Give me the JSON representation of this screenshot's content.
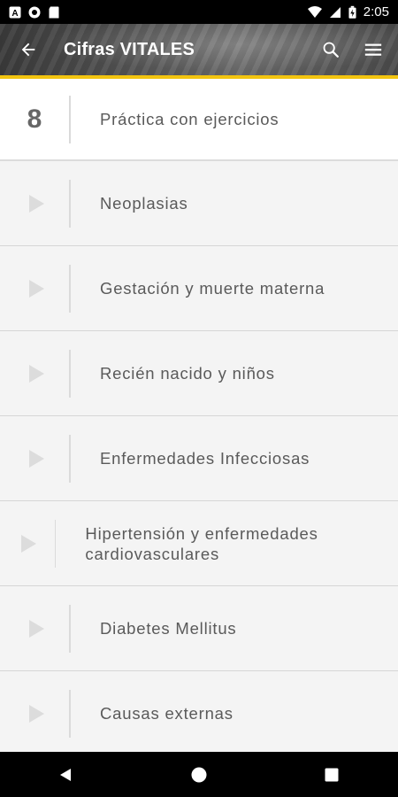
{
  "status_bar": {
    "time": "2:05",
    "left_icons": [
      "app-a-icon",
      "circle-app-icon",
      "sd-card-icon"
    ],
    "right_icons": [
      "wifi-icon",
      "signal-icon",
      "battery-icon"
    ]
  },
  "app_bar": {
    "title": "Cifras VITALES",
    "back_icon": "back-arrow-icon",
    "search_icon": "search-icon",
    "menu_icon": "menu-icon",
    "accent_color": "#f2c40f"
  },
  "list": {
    "items": [
      {
        "marker": "8",
        "label": "Práctica con ejercicios",
        "active": true
      },
      {
        "marker": "play-icon",
        "label": "Neoplasias"
      },
      {
        "marker": "play-icon",
        "label": "Gestación y muerte materna"
      },
      {
        "marker": "play-icon",
        "label": "Recién nacido y niños"
      },
      {
        "marker": "play-icon",
        "label": "Enfermedades Infecciosas"
      },
      {
        "marker": "play-icon",
        "label": "Hipertensión y enfermedades cardiovasculares"
      },
      {
        "marker": "play-icon",
        "label": "Diabetes Mellitus"
      },
      {
        "marker": "play-icon",
        "label": "Causas externas"
      }
    ]
  },
  "nav_bar": {
    "buttons": [
      "nav-back-icon",
      "nav-home-icon",
      "nav-recents-icon"
    ]
  }
}
